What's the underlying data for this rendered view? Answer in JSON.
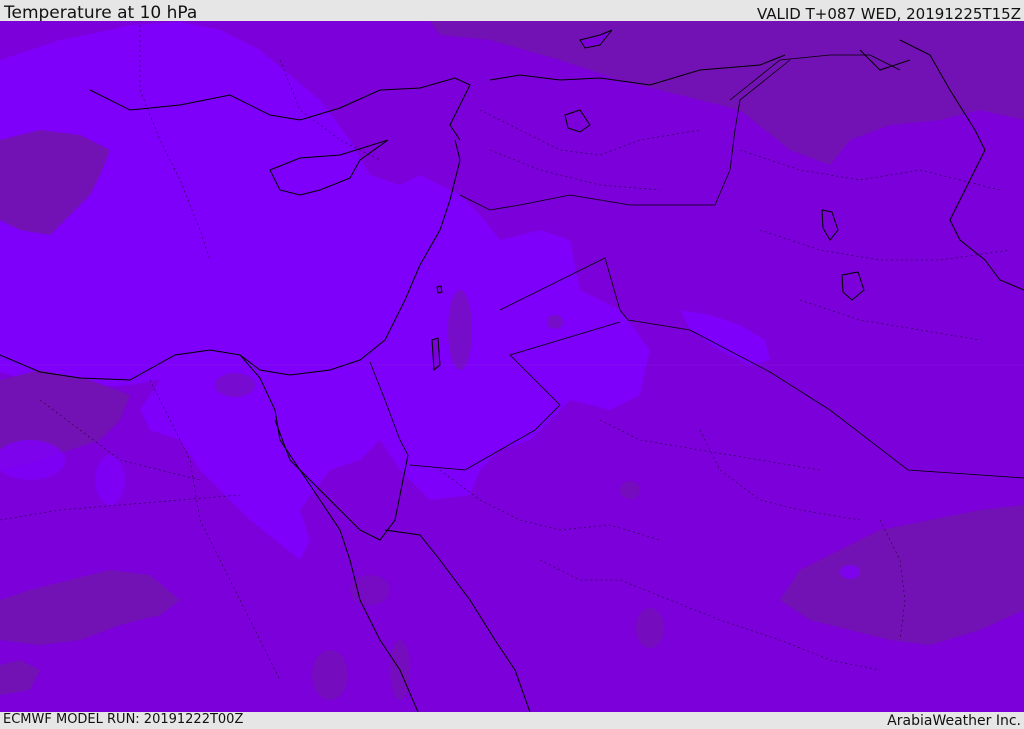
{
  "header": {
    "title": "Temperature at 10 hPa",
    "valid": "VALID T+087 WED, 20191225T15Z"
  },
  "footer": {
    "model_run": "ECMWF MODEL RUN: 20191222T00Z",
    "credit": "ArabiaWeather Inc."
  },
  "map": {
    "region": "Eastern Mediterranean and Middle East",
    "variable": "temperature",
    "level": "10 hPa",
    "colors": {
      "base": "#7b00d9",
      "light_band": "#7e00fa",
      "dark_band": "#7312b4",
      "mid_band": "#7f00ea",
      "coastline": "#000000",
      "border": "#3a0070"
    }
  }
}
